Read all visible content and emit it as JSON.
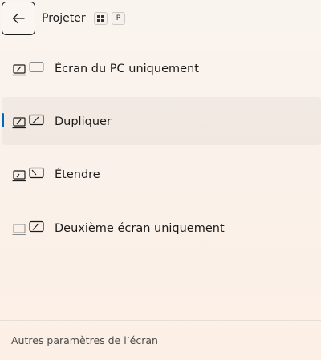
{
  "header": {
    "title": "Projeter",
    "shortcut_win": "⊞",
    "shortcut_key": "P"
  },
  "options": [
    {
      "label": "Écran du PC uniquement",
      "icon": "pc-screen-only-icon",
      "selected": false
    },
    {
      "label": "Dupliquer",
      "icon": "duplicate-icon",
      "selected": true
    },
    {
      "label": "Étendre",
      "icon": "extend-icon",
      "selected": false
    },
    {
      "label": "Deuxième écran uniquement",
      "icon": "second-screen-only-icon",
      "selected": false
    }
  ],
  "footer": {
    "link": "Autres paramètres de l’écran"
  },
  "colors": {
    "accent": "#0067c0"
  }
}
